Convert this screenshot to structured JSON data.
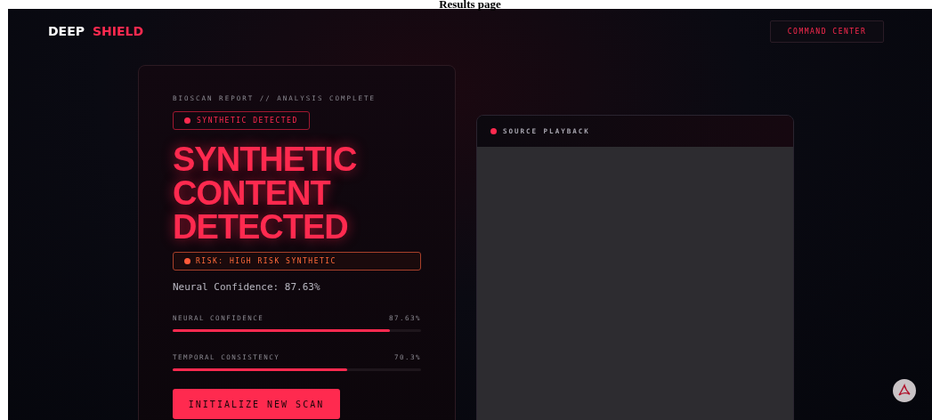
{
  "caption": "Results page",
  "brand": {
    "part_1": "DEEP",
    "part_2": "SHIELD"
  },
  "nav_button": "COMMAND CENTER",
  "report": {
    "eyebrow": "BIOSCAN REPORT // ANALYSIS COMPLETE",
    "status_badge": "SYNTHETIC DETECTED",
    "headline": "SYNTHETIC CONTENT DETECTED",
    "risk_badge": "RISK: HIGH RISK SYNTHETIC",
    "summary": "Neural Confidence: 87.63%",
    "metrics": [
      {
        "label": "NEURAL CONFIDENCE",
        "reading": "87.63%",
        "level": 0.8763
      },
      {
        "label": "TEMPORAL CONSISTENCY",
        "reading": "70.3%",
        "level": 0.703
      }
    ],
    "action_button": "INITIALIZE NEW SCAN"
  },
  "player": {
    "title": "SOURCE PLAYBACK"
  }
}
